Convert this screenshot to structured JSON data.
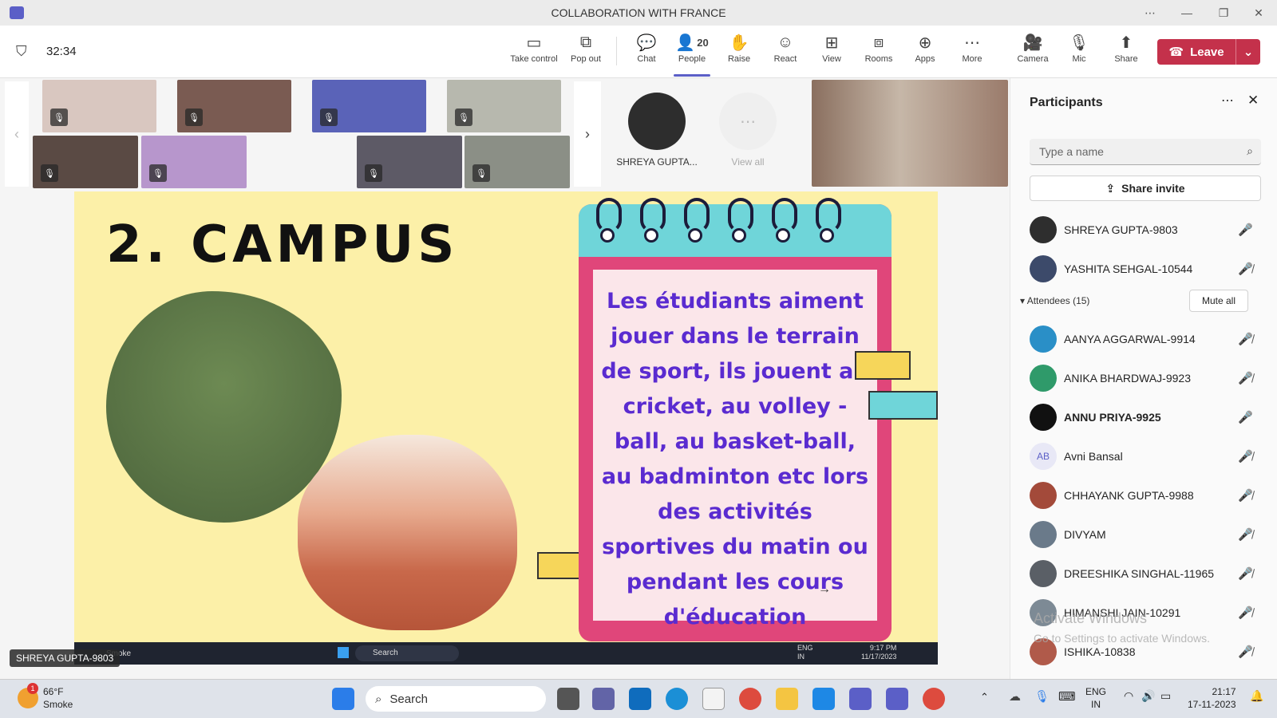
{
  "window": {
    "title": "COLLABORATION WITH FRANCE"
  },
  "toolbar": {
    "timer": "32:34",
    "buttons": [
      {
        "label": "Take control",
        "icon": "take-control-icon"
      },
      {
        "label": "Pop out",
        "icon": "pop-out-icon"
      },
      {
        "label": "Chat",
        "icon": "chat-icon"
      },
      {
        "label": "People",
        "icon": "people-icon",
        "count": "20"
      },
      {
        "label": "Raise",
        "icon": "hand-icon"
      },
      {
        "label": "React",
        "icon": "smile-icon"
      },
      {
        "label": "View",
        "icon": "view-icon"
      },
      {
        "label": "Rooms",
        "icon": "rooms-icon"
      },
      {
        "label": "Apps",
        "icon": "apps-icon"
      },
      {
        "label": "More",
        "icon": "more-icon"
      },
      {
        "label": "Camera",
        "icon": "camera-icon"
      },
      {
        "label": "Mic",
        "icon": "mic-off-icon"
      },
      {
        "label": "Share",
        "icon": "share-icon"
      }
    ],
    "leave_label": "Leave"
  },
  "strip": {
    "spotlight_name": "SHREYA GUPTA...",
    "view_all": "View all"
  },
  "slide": {
    "title": "2. CAMPUS",
    "text": "Les étudiants aiment jouer dans le terrain de sport, ils jouent au cricket, au volley -ball, au basket-ball, au badminton etc lors des activités sportives du matin ou pendant les cours d'éducation physique."
  },
  "presenter_tag": "SHREYA GUPTA-9803",
  "inner_taskbar": {
    "weather": "Smoke",
    "search": "Search",
    "lang": "ENG",
    "region": "IN",
    "time": "9:17 PM",
    "date": "11/17/2023"
  },
  "participants": {
    "title": "Participants",
    "search_placeholder": "Type a name",
    "share_invite": "Share invite",
    "presenters": [
      {
        "name": "SHREYA GUPTA-9803",
        "mic": "on"
      },
      {
        "name": "YASHITA SEHGAL-10544",
        "mic": "off"
      }
    ],
    "attendees_label": "Attendees (15)",
    "mute_all": "Mute all",
    "attendees": [
      {
        "name": "AANYA AGGARWAL-9914",
        "mic": "off"
      },
      {
        "name": "ANIKA BHARDWAJ-9923",
        "mic": "off"
      },
      {
        "name": "ANNU PRIYA-9925",
        "mic": "on"
      },
      {
        "name": "Avni Bansal",
        "initials": "AB",
        "mic": "off"
      },
      {
        "name": "CHHAYANK GUPTA-9988",
        "mic": "off"
      },
      {
        "name": "DIVYAM",
        "mic": "off"
      },
      {
        "name": "DREESHIKA SINGHAL-11965",
        "mic": "off"
      },
      {
        "name": "HIMANSHI JAIN-10291",
        "mic": "off"
      },
      {
        "name": "ISHIKA-10838",
        "mic": "off"
      }
    ]
  },
  "watermark": {
    "line1": "Activate Windows",
    "line2": "Go to Settings to activate Windows."
  },
  "taskbar": {
    "temp": "66°F",
    "weather": "Smoke",
    "badge": "1",
    "search": "Search",
    "lang": "ENG",
    "region": "IN",
    "time": "21:17",
    "date": "17-11-2023"
  }
}
